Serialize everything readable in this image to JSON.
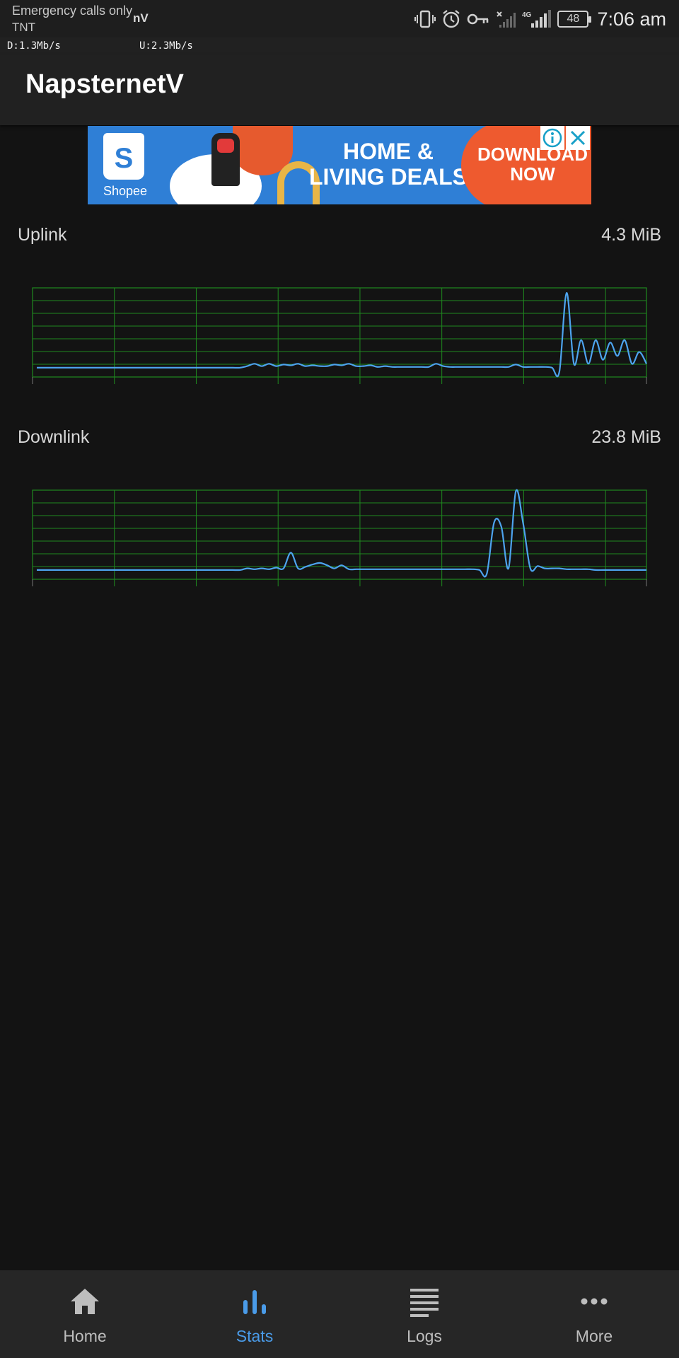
{
  "status_bar": {
    "carrier_line1": "Emergency calls only",
    "carrier_line2": "TNT",
    "app_badge": "nV",
    "network_type": "4G",
    "battery": "48",
    "time": "7:06 am"
  },
  "speed_overlay": {
    "download": "D:1.3Mb/s",
    "upload": "U:2.3Mb/s"
  },
  "app_bar": {
    "title": "NapsternetV"
  },
  "ad": {
    "brand": "Shopee",
    "logo_letter": "S",
    "headline_line1": "HOME &",
    "headline_line2": "LIVING DEALS",
    "cta_line1": "DOWNLOAD",
    "cta_line2": "NOW",
    "colors": {
      "background": "#2f7fd6",
      "cta": "#ee5a2f"
    }
  },
  "stats": {
    "uplink": {
      "label": "Uplink",
      "value": "4.3 MiB"
    },
    "downlink": {
      "label": "Downlink",
      "value": "23.8 MiB"
    }
  },
  "chart_data": [
    {
      "type": "line",
      "series": [
        {
          "values": [
            0,
            0,
            0,
            0,
            0,
            0,
            0,
            0,
            0,
            0,
            0,
            0,
            0,
            0,
            0,
            0,
            0,
            0,
            0,
            0,
            0,
            0,
            0,
            0,
            0,
            0,
            0,
            0,
            0,
            0.02,
            0.05,
            0.02,
            0.05,
            0.02,
            0.04,
            0.03,
            0.05,
            0.02,
            0.03,
            0.02,
            0.02,
            0.04,
            0.03,
            0.05,
            0.02,
            0.02,
            0.03,
            0.01,
            0.02,
            0.01,
            0.01,
            0.01,
            0.01,
            0.01,
            0.01,
            0.05,
            0.02,
            0.01,
            0.01,
            0.01,
            0.01,
            0.01,
            0.01,
            0.01,
            0.01,
            0.01,
            0.04,
            0.01,
            0.01,
            0.01,
            0.01,
            0,
            -0.05,
            0.95,
            0.05,
            0.35,
            0.05,
            0.35,
            0.1,
            0.32,
            0.15,
            0.35,
            0.05,
            0.2,
            0.05
          ]
        }
      ],
      "ylim": [
        -0.1,
        1.05
      ],
      "grid": true,
      "colors": {
        "line": "#4da3ee",
        "grid": "#1f8a1f"
      }
    },
    {
      "type": "line",
      "series": [
        {
          "values": [
            0,
            0,
            0,
            0,
            0,
            0,
            0,
            0,
            0,
            0,
            0,
            0,
            0,
            0,
            0,
            0,
            0,
            0,
            0,
            0,
            0,
            0,
            0,
            0,
            0,
            0,
            0,
            0,
            0,
            0.02,
            0.01,
            0.02,
            0.01,
            0.03,
            0.02,
            0.22,
            0.02,
            0.04,
            0.07,
            0.09,
            0.06,
            0.02,
            0.06,
            0.01,
            0.01,
            0.01,
            0.01,
            0.01,
            0.01,
            0.01,
            0.01,
            0.01,
            0.01,
            0.01,
            0.01,
            0.01,
            0.01,
            0.01,
            0.01,
            0.01,
            0.01,
            0,
            -0.05,
            0.6,
            0.55,
            0.02,
            1.0,
            0.6,
            0.02,
            0.05,
            0.02,
            0.02,
            0.02,
            0.01,
            0.01,
            0.01,
            0.01,
            0,
            0,
            0,
            0,
            0,
            0,
            0,
            0
          ]
        }
      ],
      "ylim": [
        -0.1,
        1.05
      ],
      "grid": true,
      "colors": {
        "line": "#4da3ee",
        "grid": "#1f8a1f"
      }
    }
  ],
  "bottom_nav": {
    "items": [
      {
        "label": "Home",
        "icon": "home-icon"
      },
      {
        "label": "Stats",
        "icon": "stats-icon",
        "active": true
      },
      {
        "label": "Logs",
        "icon": "logs-icon"
      },
      {
        "label": "More",
        "icon": "more-icon"
      }
    ],
    "colors": {
      "active": "#4a9be8",
      "inactive": "#bdbdbd"
    }
  }
}
